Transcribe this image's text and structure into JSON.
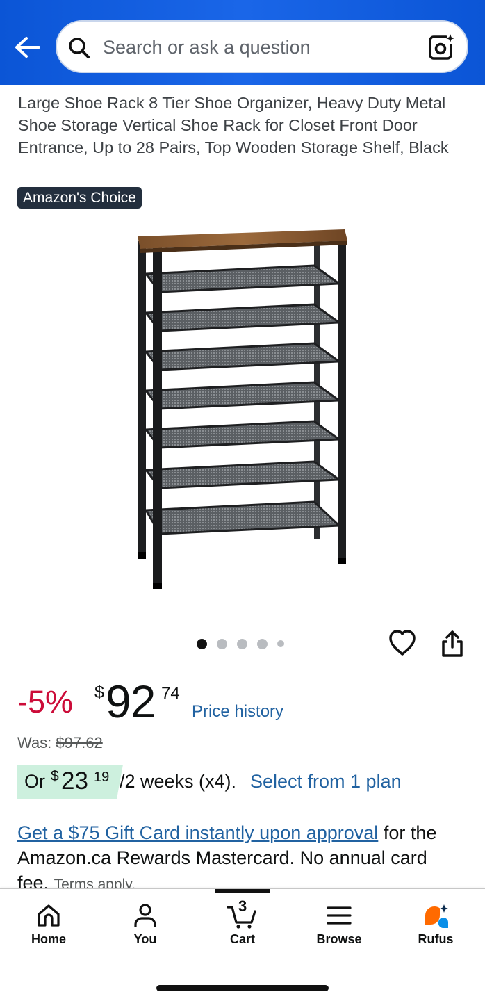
{
  "header": {
    "search_placeholder": "Search or ask a question",
    "icons": [
      "back-arrow-icon",
      "search-icon",
      "camera-lens-icon"
    ]
  },
  "product": {
    "title": "Large Shoe Rack 8 Tier Shoe Organizer, Heavy Duty Metal Shoe Storage Vertical Shoe Rack for Closet Front Door Entrance, Up to 28 Pairs, Top Wooden Storage Shelf, Black",
    "badge": "Amazon's Choice",
    "image_count": 5,
    "active_image": 1
  },
  "pricing": {
    "discount": "-5%",
    "currency_symbol": "$",
    "price_whole": "92",
    "price_fraction": "74",
    "price_history_label": "Price history",
    "was_label": "Was:",
    "was_price": "$97.62"
  },
  "installment": {
    "or_label": "Or",
    "currency_symbol": "$",
    "amount_whole": "23",
    "amount_fraction": "19",
    "terms": "/2 weeks (x4).",
    "link": "Select from 1 plan"
  },
  "promo": {
    "link": "Get a $75 Gift Card instantly upon approval",
    "text": " for the Amazon.ca Rewards Mastercard. No annual card fee.",
    "terms": "Terms apply."
  },
  "tabbar": {
    "home": "Home",
    "you": "You",
    "cart": "Cart",
    "cart_count": "3",
    "browse": "Browse",
    "rufus": "Rufus"
  },
  "colors": {
    "header_blue": "#0b55d6",
    "discount_red": "#cc0c39",
    "link_blue": "#2162a1",
    "badge_bg": "#232f3e",
    "installment_bg": "#cdf0de",
    "rufus_orange": "#ff6a00",
    "rufus_blue": "#0a8fe8"
  }
}
